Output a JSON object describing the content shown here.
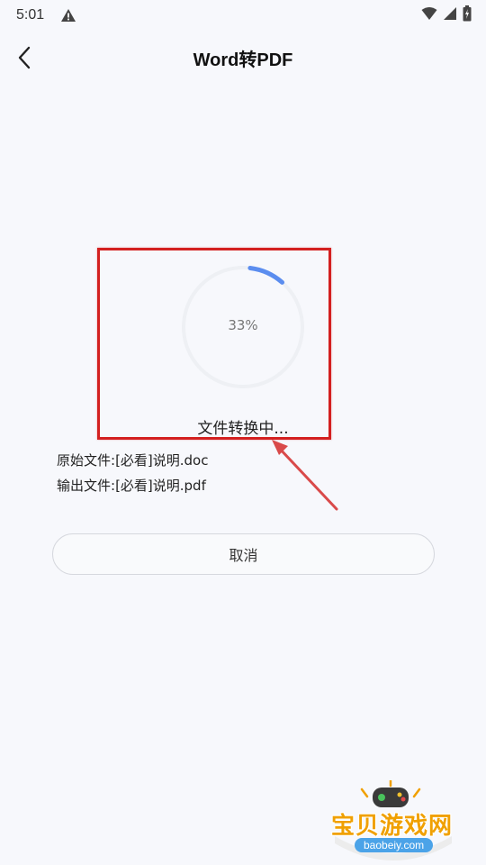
{
  "status_bar": {
    "time": "5:01"
  },
  "header": {
    "title": "Word转PDF"
  },
  "progress": {
    "value": 33,
    "label": "33%",
    "status": "文件转换中..."
  },
  "file_info": {
    "source_label": "原始文件:",
    "source_name": "[必看]说明.doc",
    "output_label": "输出文件:",
    "output_name": "[必看]说明.pdf"
  },
  "actions": {
    "cancel_label": "取消"
  },
  "watermark": {
    "brand": "宝贝游戏网",
    "url": "baobeiy.com"
  },
  "colors": {
    "accent": "#5b8def",
    "highlight": "#d32020",
    "background": "#f7f8fc"
  }
}
